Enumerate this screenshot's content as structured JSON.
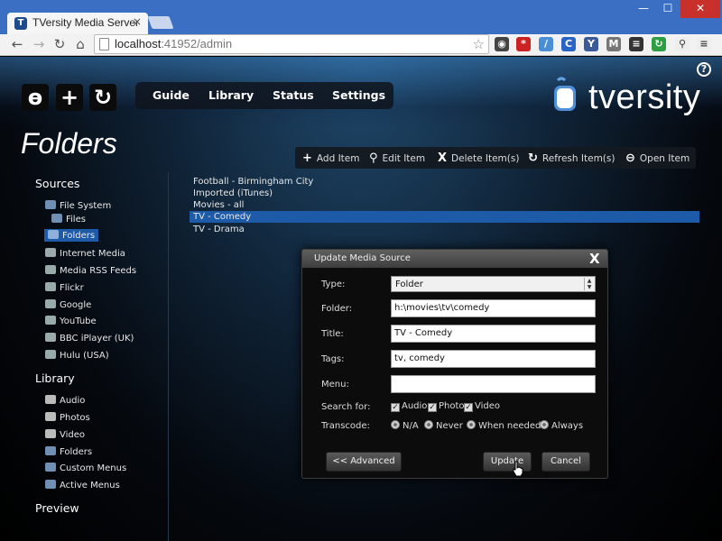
{
  "browser": {
    "tab_title": "TVersity Media Server",
    "tab_close": "×",
    "url_host": "localhost",
    "url_path": ":41952/admin",
    "window_min": "—",
    "window_max": "☐",
    "window_close": "✕"
  },
  "app": {
    "logo_text": "tversity",
    "nav": [
      "Guide",
      "Library",
      "Status",
      "Settings"
    ],
    "page_title": "Folders",
    "help": "?"
  },
  "actions": [
    {
      "icon": "+",
      "label": "Add Item"
    },
    {
      "icon": "⚲",
      "label": "Edit Item"
    },
    {
      "icon": "X",
      "label": "Delete Item(s)"
    },
    {
      "icon": "↻",
      "label": "Refresh Item(s)"
    },
    {
      "icon": "⊖",
      "label": "Open Item"
    }
  ],
  "sidebar": {
    "sources_heading": "Sources",
    "sources": [
      {
        "label": "File System",
        "icon": "folder-icon",
        "color": "#6f8fb4"
      },
      {
        "label": "Files",
        "icon": "folder-icon",
        "color": "#6f8fb4"
      },
      {
        "label": "Folders",
        "icon": "folder-icon",
        "color": "#6f8fb4"
      },
      {
        "label": "Internet Media",
        "icon": "globe-icon",
        "color": "#9aa"
      },
      {
        "label": "Media RSS Feeds",
        "icon": "rss-icon",
        "color": "#9aa"
      },
      {
        "label": "Flickr",
        "icon": "feed-icon",
        "color": "#9aa"
      },
      {
        "label": "Google",
        "icon": "feed-icon",
        "color": "#9aa"
      },
      {
        "label": "YouTube",
        "icon": "feed-icon",
        "color": "#9aa"
      },
      {
        "label": "BBC iPlayer (UK)",
        "icon": "feed-icon",
        "color": "#9aa"
      },
      {
        "label": "Hulu (USA)",
        "icon": "feed-icon",
        "color": "#9aa"
      }
    ],
    "library_heading": "Library",
    "library": [
      {
        "label": "Audio",
        "icon": "audio-icon",
        "color": "#bbb"
      },
      {
        "label": "Photos",
        "icon": "photos-icon",
        "color": "#bbb"
      },
      {
        "label": "Video",
        "icon": "video-icon",
        "color": "#bbb"
      },
      {
        "label": "Folders",
        "icon": "folder-icon",
        "color": "#6f8fb4"
      },
      {
        "label": "Custom Menus",
        "icon": "menu-icon",
        "color": "#6f8fb4"
      },
      {
        "label": "Active Menus",
        "icon": "menu-icon",
        "color": "#6f8fb4"
      }
    ],
    "preview_heading": "Preview"
  },
  "folders": [
    "Football - Birmingham City",
    "Imported (iTunes)",
    "Movies - all",
    "TV - Comedy",
    "TV - Drama"
  ],
  "selected_folder_index": 3,
  "dialog": {
    "title": "Update Media Source",
    "close": "X",
    "type_label": "Type:",
    "type_value": "Folder",
    "folder_label": "Folder:",
    "folder_value": "h:\\movies\\tv\\comedy",
    "title_label": "Title:",
    "title_value": "TV - Comedy",
    "tags_label": "Tags:",
    "tags_value": "tv, comedy",
    "menu_label": "Menu:",
    "menu_value": "",
    "search_label": "Search for:",
    "search_options": [
      {
        "label": "Audio",
        "checked": true
      },
      {
        "label": "Photo",
        "checked": true
      },
      {
        "label": "Video",
        "checked": true
      }
    ],
    "transcode_label": "Transcode:",
    "transcode_options": [
      "N/A",
      "Never",
      "When needed",
      "Always"
    ],
    "advanced_button": "<< Advanced",
    "update_button": "Update",
    "cancel_button": "Cancel"
  }
}
